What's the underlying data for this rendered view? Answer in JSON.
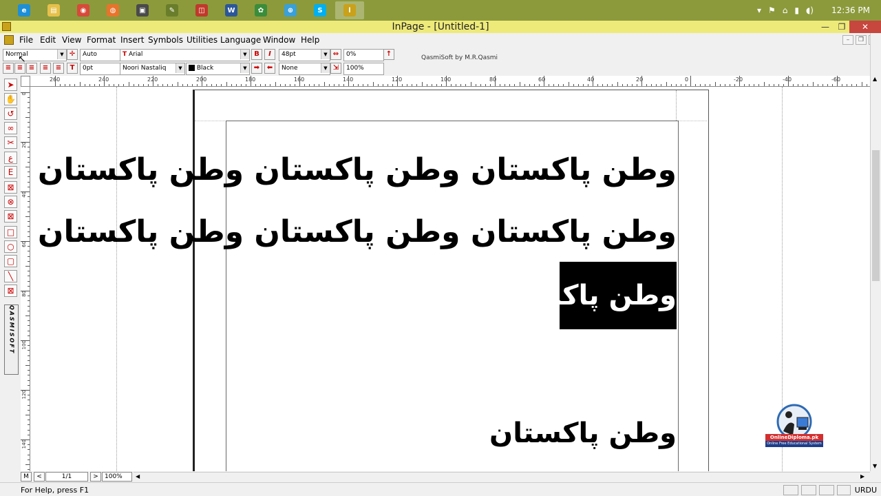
{
  "taskbar": {
    "apps": [
      {
        "icon": "internet-explorer-icon",
        "color": "#1e8fd6",
        "glyph": "e"
      },
      {
        "icon": "file-explorer-icon",
        "color": "#e6c04a",
        "glyph": "▤"
      },
      {
        "icon": "chrome-icon",
        "color": "#d84a3a",
        "glyph": "◉"
      },
      {
        "icon": "firefox-icon",
        "color": "#e8742c",
        "glyph": "◍"
      },
      {
        "icon": "photo-app-icon",
        "color": "#4a4a4a",
        "glyph": "▣"
      },
      {
        "icon": "notepad-icon",
        "color": "#6a7d2a",
        "glyph": "✎"
      },
      {
        "icon": "pdf-reader-icon",
        "color": "#c0392b",
        "glyph": "◫"
      },
      {
        "icon": "word-icon",
        "color": "#2b579a",
        "glyph": "W"
      },
      {
        "icon": "camtasia-icon",
        "color": "#3a8d3a",
        "glyph": "✿"
      },
      {
        "icon": "network-icon",
        "color": "#3aa0d8",
        "glyph": "⊕"
      },
      {
        "icon": "skype-icon",
        "color": "#00aff0",
        "glyph": "S"
      },
      {
        "icon": "inpage-icon",
        "color": "#c9a11a",
        "glyph": "ا"
      }
    ],
    "clock": "12:36 PM"
  },
  "window": {
    "title": "InPage - [Untitled-1]"
  },
  "menu": [
    "File",
    "Edit",
    "View",
    "Format",
    "Insert",
    "Symbols",
    "Utilities",
    "Language",
    "Window",
    "Help"
  ],
  "toolbar": {
    "style": "Normal",
    "leading": "Auto",
    "font_english": "Arial",
    "font_size": "48pt",
    "tracking": "0%",
    "indent": "0pt",
    "font_urdu": "Noori Nastaliq",
    "color": "Black",
    "shade": "None",
    "scale": "100%",
    "credit": "QasmiSoft by M.R.Qasmi"
  },
  "ruler_top": [
    "260",
    "240",
    "220",
    "200",
    "180",
    "160",
    "140",
    "120",
    "100",
    "80",
    "60",
    "40",
    "20",
    "0",
    "-20",
    "-40",
    "-60"
  ],
  "ruler_left": [
    "0",
    "20",
    "40",
    "60",
    "80",
    "100",
    "120",
    "140"
  ],
  "tool_palette_brand": "QASMISOFT",
  "document": {
    "line1": "وطن پاکستان وطن پاکستان وطن پاکستان",
    "line2": "وطن پاکستان وطن پاکستان وطن پاکستان",
    "selected": "وطن پاکستان",
    "line4": "وطن پاکستان"
  },
  "nav": {
    "master": "M",
    "prev": "<",
    "page": "1/1",
    "next": ">",
    "zoom": "100%"
  },
  "status": {
    "help": "For Help, press F1",
    "language": "URDU"
  },
  "watermark": {
    "site": "OnlineDiploma.pk",
    "tagline": "Online Free Educational System"
  }
}
